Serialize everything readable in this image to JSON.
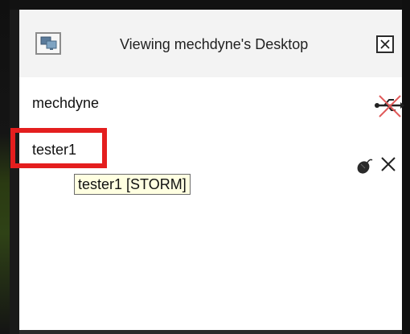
{
  "window": {
    "title": "Viewing mechdyne's Desktop",
    "app_icon": "shared-desktop-icon",
    "close_icon": "close-icon"
  },
  "users": [
    {
      "name": "mechdyne",
      "status_icon": "usb-disconnected-icon"
    },
    {
      "name": "tester1",
      "status_icon": "mouse-control-icon",
      "action_icon": "remove-icon"
    }
  ],
  "tooltip": {
    "text": "tester1 [STORM]"
  },
  "colors": {
    "highlight": "#e41e1e",
    "tooltip_bg": "#ffffe1",
    "titlebar_bg": "#f3f3f3"
  }
}
